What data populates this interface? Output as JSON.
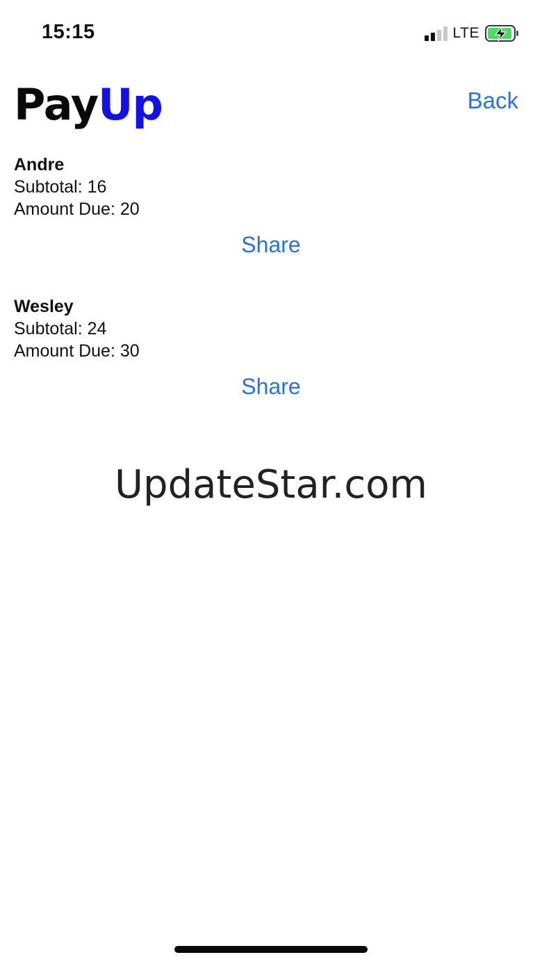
{
  "status_bar": {
    "time": "15:15",
    "network": "LTE",
    "icons": [
      "signal-icon",
      "battery-charging-icon"
    ],
    "battery_color": "#4cd964"
  },
  "header": {
    "logo_part1": "Pay",
    "logo_part2": "Up",
    "logo_accent_color": "#1212e6",
    "back_label": "Back"
  },
  "people": [
    {
      "name": "Andre",
      "subtotal_label": "Subtotal: 16",
      "amount_due_label": "Amount Due: 20",
      "share_label": "Share"
    },
    {
      "name": "Wesley",
      "subtotal_label": "Subtotal: 24",
      "amount_due_label": "Amount Due: 30",
      "share_label": "Share"
    }
  ],
  "watermark": "UpdateStar.com",
  "link_color": "#2a72d6"
}
